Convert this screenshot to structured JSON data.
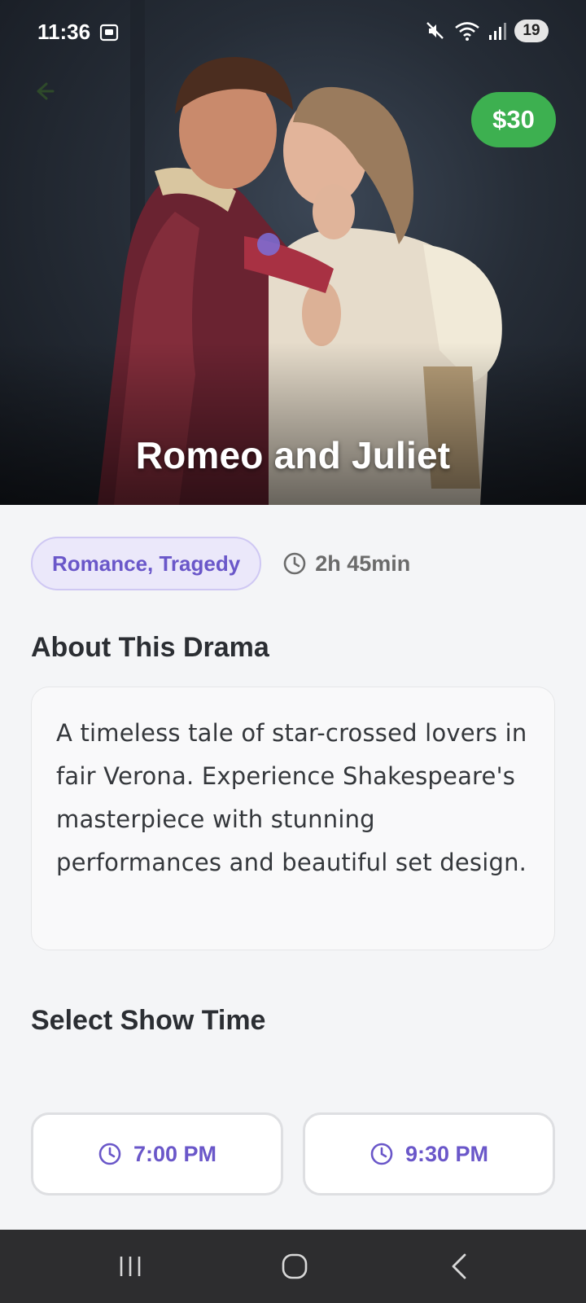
{
  "status_bar": {
    "time": "11:36",
    "battery": "19",
    "icons": [
      "screenshot-icon",
      "mute-icon",
      "wifi-icon",
      "signal-icon"
    ]
  },
  "hero": {
    "title": "Romeo and Juliet",
    "price": "$30",
    "back_icon": "arrow-left-icon"
  },
  "details": {
    "genre": "Romance, Tragedy",
    "duration": "2h 45min"
  },
  "about": {
    "heading": "About This Drama",
    "description": "A timeless tale of star-crossed lovers in fair Verona. Experience Shakespeare's masterpiece with stunning performances and beautiful set design."
  },
  "showtimes": {
    "heading": "Select Show Time",
    "times": [
      "7:00 PM",
      "9:30 PM"
    ]
  },
  "colors": {
    "accent": "#6a57c9",
    "price_badge": "#3db050"
  },
  "nav": {
    "icons": [
      "recents-icon",
      "home-icon",
      "back-icon"
    ]
  }
}
